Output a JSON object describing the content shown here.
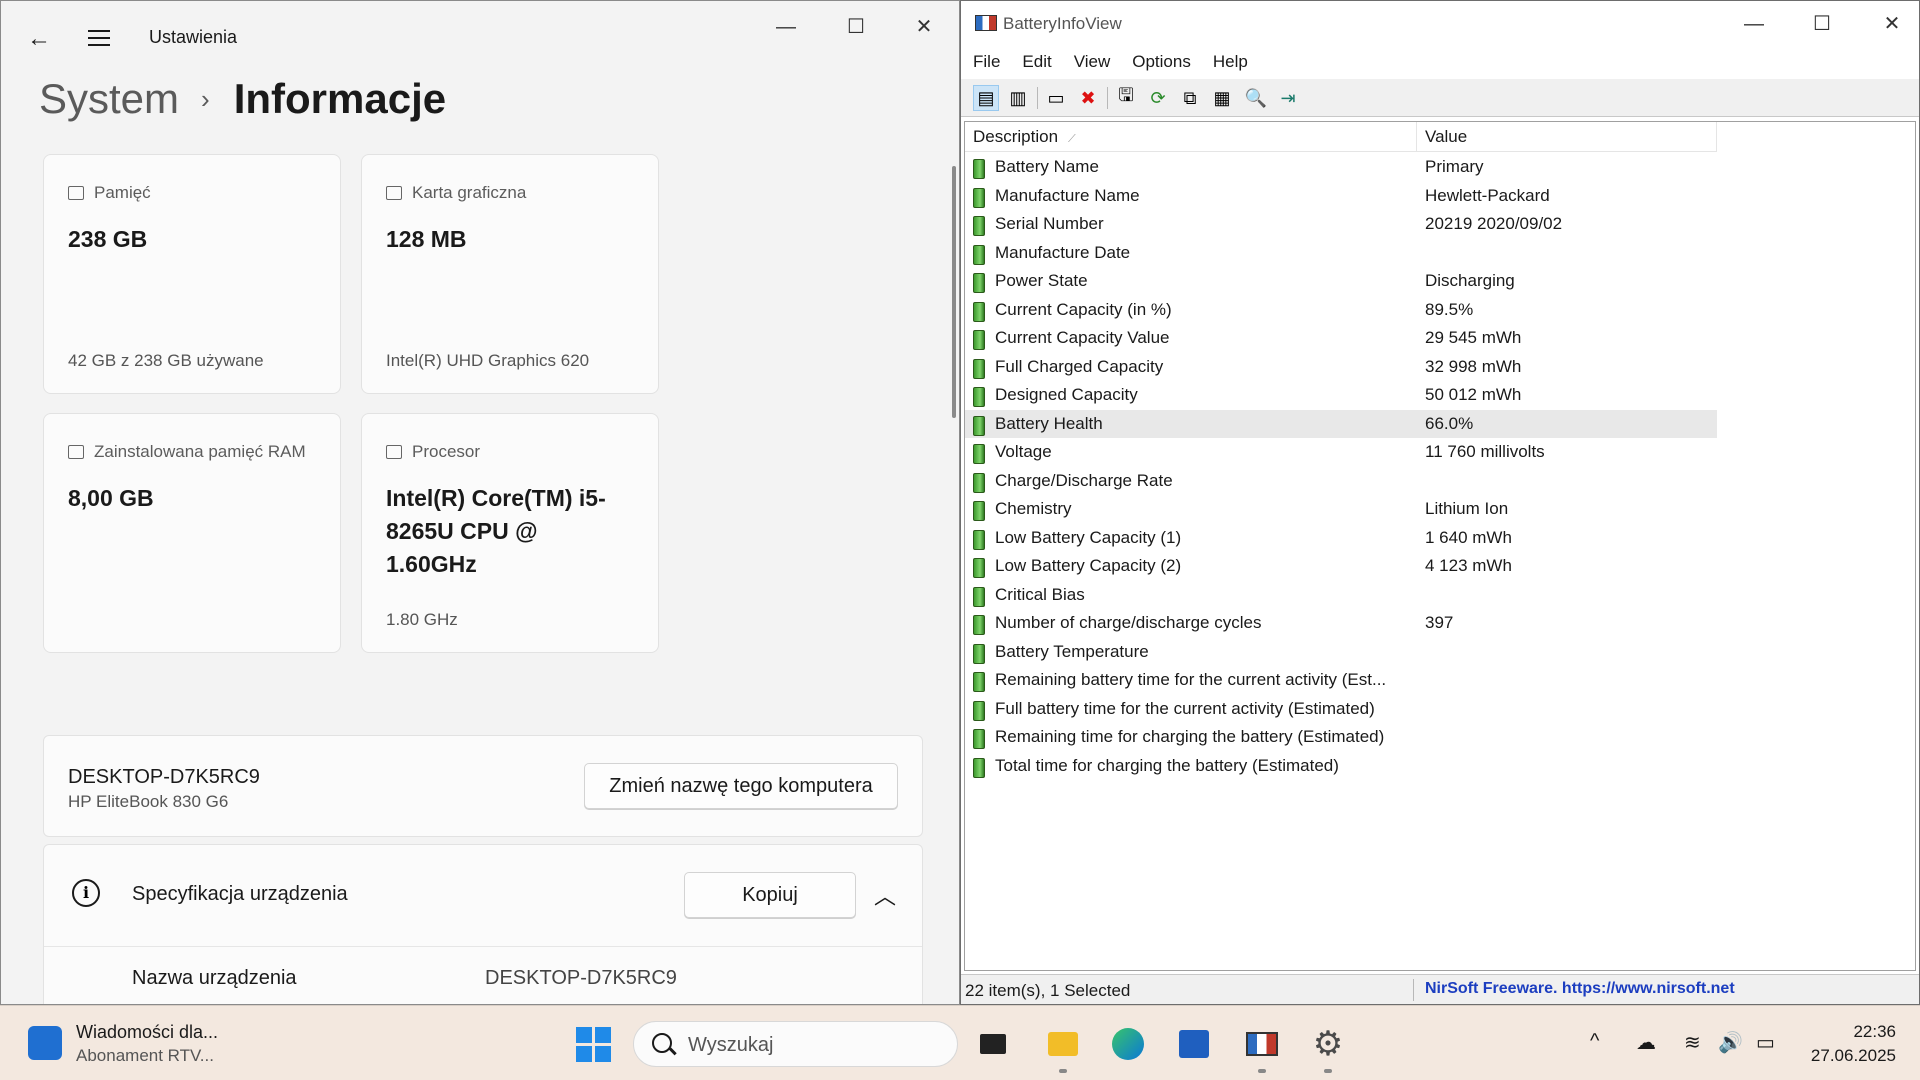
{
  "settings": {
    "app_title": "Ustawienia",
    "breadcrumb_root": "System",
    "breadcrumb_sep": "›",
    "breadcrumb_current": "Informacje",
    "cards": [
      {
        "label": "Pamięć",
        "value": "238 GB",
        "sub": "42 GB z 238 GB używane"
      },
      {
        "label": "Karta graficzna",
        "value": "128 MB",
        "sub": "Intel(R) UHD Graphics 620"
      },
      {
        "label": "Zainstalowana pamięć RAM",
        "value": "8,00 GB",
        "sub": ""
      },
      {
        "label": "Procesor",
        "value": "Intel(R) Core(TM) i5-8265U CPU @ 1.60GHz",
        "sub": "1.80 GHz"
      }
    ],
    "device_name": "DESKTOP-D7K5RC9",
    "device_model": "HP EliteBook 830 G6",
    "rename_button": "Zmień nazwę tego komputera",
    "spec_title": "Specyfikacja urządzenia",
    "copy_button": "Kopiuj",
    "spec_row_key": "Nazwa urządzenia",
    "spec_row_value": "DESKTOP-D7K5RC9"
  },
  "battery_view": {
    "app_title": "BatteryInfoView",
    "menu": [
      "File",
      "Edit",
      "View",
      "Options",
      "Help"
    ],
    "columns": [
      "Description",
      "Value"
    ],
    "rows": [
      {
        "desc": "Battery Name",
        "value": "Primary"
      },
      {
        "desc": "Manufacture Name",
        "value": "Hewlett-Packard"
      },
      {
        "desc": "Serial Number",
        "value": "20219 2020/09/02"
      },
      {
        "desc": "Manufacture Date",
        "value": ""
      },
      {
        "desc": "Power State",
        "value": "Discharging"
      },
      {
        "desc": "Current Capacity (in %)",
        "value": "89.5%"
      },
      {
        "desc": "Current Capacity Value",
        "value": "29 545 mWh"
      },
      {
        "desc": "Full Charged Capacity",
        "value": "32 998 mWh"
      },
      {
        "desc": "Designed Capacity",
        "value": "50 012 mWh"
      },
      {
        "desc": "Battery Health",
        "value": "66.0%",
        "selected": true
      },
      {
        "desc": "Voltage",
        "value": "11 760 millivolts"
      },
      {
        "desc": "Charge/Discharge Rate",
        "value": ""
      },
      {
        "desc": "Chemistry",
        "value": "Lithium Ion"
      },
      {
        "desc": "Low Battery Capacity (1)",
        "value": "1 640 mWh"
      },
      {
        "desc": "Low Battery Capacity (2)",
        "value": "4 123 mWh"
      },
      {
        "desc": "Critical Bias",
        "value": ""
      },
      {
        "desc": "Number of charge/discharge cycles",
        "value": "397"
      },
      {
        "desc": "Battery Temperature",
        "value": ""
      },
      {
        "desc": "Remaining battery time for the current activity (Est...",
        "value": ""
      },
      {
        "desc": "Full battery time for the current activity (Estimated)",
        "value": ""
      },
      {
        "desc": "Remaining time for charging the battery (Estimated)",
        "value": ""
      },
      {
        "desc": "Total  time for charging the battery (Estimated)",
        "value": ""
      }
    ],
    "status_left": "22 item(s), 1 Selected",
    "status_right": "NirSoft Freeware. https://www.nirsoft.net"
  },
  "taskbar": {
    "news_title": "Wiadomości dla...",
    "news_sub": "Abonament RTV...",
    "search_placeholder": "Wyszukaj",
    "time": "22:36",
    "date": "27.06.2025"
  },
  "colors": {
    "accent": "#1f8ae8",
    "nirsoft_link": "#1c3ec0",
    "battery_green": "#3d9a2e"
  }
}
